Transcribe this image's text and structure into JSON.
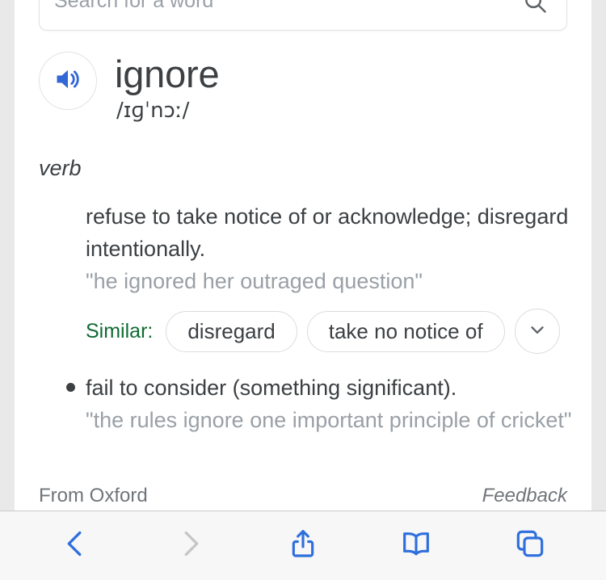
{
  "search": {
    "placeholder": "Search for a word",
    "value": "",
    "icon": "search-icon"
  },
  "entry": {
    "headword": "ignore",
    "phonetic": "/ɪɡˈnɔː/",
    "speaker_icon": "speaker-icon",
    "part_of_speech": "verb",
    "senses": [
      {
        "definition": "refuse to take notice of or acknowledge; disregard intentionally.",
        "example": "\"he ignored her outraged question\"",
        "similar_label": "Similar:",
        "similar_terms": [
          "disregard",
          "take no notice of"
        ],
        "expand_icon": "chevron-down-icon"
      },
      {
        "definition": "fail to consider (something significant).",
        "example": "\"the rules ignore one important principle of cricket\""
      }
    ]
  },
  "footer": {
    "source": "From Oxford",
    "feedback": "Feedback"
  },
  "toolbar": {
    "back": "back-icon",
    "forward": "forward-icon",
    "share": "share-icon",
    "bookmarks": "bookmarks-icon",
    "tabs": "tabs-icon"
  },
  "colors": {
    "accent_blue": "#2f6fdd",
    "disabled_grey": "#c6c6c8",
    "similar_green": "#0f6b33",
    "text_primary": "#3c4043",
    "text_muted": "#9aa0a6"
  }
}
